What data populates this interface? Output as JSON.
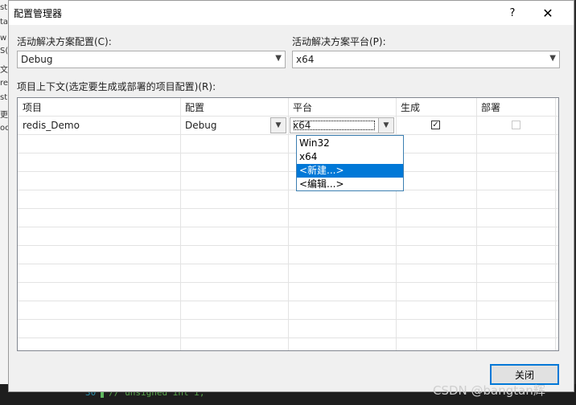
{
  "dialog": {
    "title": "配置管理器",
    "help": "?",
    "close": "✕"
  },
  "solution": {
    "config_label": "活动解决方案配置(C):",
    "config_value": "Debug",
    "platform_label": "活动解决方案平台(P):",
    "platform_value": "x64",
    "context_label": "项目上下文(选定要生成或部署的项目配置)(R):"
  },
  "grid": {
    "headers": {
      "project": "项目",
      "config": "配置",
      "platform": "平台",
      "build": "生成",
      "deploy": "部署"
    },
    "row": {
      "project": "redis_Demo",
      "config": "Debug",
      "platform": "x64",
      "build_checked": true,
      "deploy_checked": false,
      "deploy_enabled": false
    }
  },
  "platform_dropdown": {
    "options": [
      "Win32",
      "x64",
      "<新建...>",
      "<编辑...>"
    ],
    "highlighted_index": 2
  },
  "buttons": {
    "close": "关闭"
  },
  "background": {
    "sidebar_fragments": [
      "st",
      "ta",
      "w",
      "S(",
      "文",
      "re",
      "st",
      "更",
      "oc"
    ],
    "code_line_number": "30",
    "code_text": "// unsigned int i;"
  },
  "watermark": "CSDN @bangtan辉",
  "icons": {
    "dropdown_arrow": "chevron-down-icon",
    "check": "checkmark-icon"
  }
}
